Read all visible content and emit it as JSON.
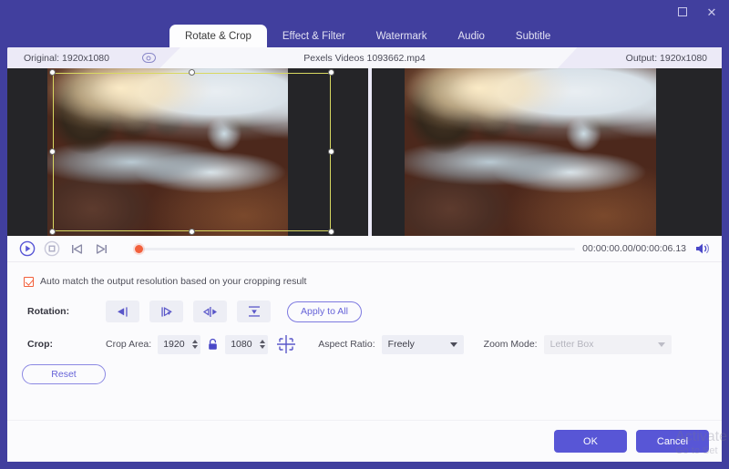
{
  "window": {
    "maximize_label": "maximize",
    "close_label": "close"
  },
  "tabs": [
    {
      "label": "Rotate & Crop",
      "active": true
    },
    {
      "label": "Effect & Filter",
      "active": false
    },
    {
      "label": "Watermark",
      "active": false
    },
    {
      "label": "Audio",
      "active": false
    },
    {
      "label": "Subtitle",
      "active": false
    }
  ],
  "info": {
    "original": "Original: 1920x1080",
    "filename": "Pexels Videos 1093662.mp4",
    "output": "Output: 1920x1080",
    "eye_icon": "eye-icon"
  },
  "player": {
    "play_icon": "play-circle-icon",
    "stop_icon": "stop-circle-icon",
    "prev_icon": "skip-previous-icon",
    "next_icon": "skip-next-icon",
    "timecode": "00:00:00.00/00:00:06.13",
    "volume_icon": "speaker-icon"
  },
  "settings": {
    "auto_match_label": "Auto match the output resolution based on your cropping result",
    "auto_match_checked": true,
    "rotation_label": "Rotation:",
    "rotation_buttons": [
      {
        "name": "rotate-left-icon"
      },
      {
        "name": "rotate-right-icon"
      },
      {
        "name": "flip-horizontal-icon"
      },
      {
        "name": "flip-vertical-icon"
      }
    ],
    "apply_to_all_label": "Apply to All",
    "crop_label": "Crop:",
    "crop_area_label": "Crop Area:",
    "crop_width": "1920",
    "crop_height": "1080",
    "lock_icon": "lock-icon",
    "crop_grid_icon": "crop-grid-icon",
    "aspect_ratio_label": "Aspect Ratio:",
    "aspect_ratio_value": "Freely",
    "zoom_mode_label": "Zoom Mode:",
    "zoom_mode_value": "Letter Box",
    "zoom_mode_disabled": true,
    "reset_label": "Reset"
  },
  "footer": {
    "ok_label": "OK",
    "cancel_label": "Cancel",
    "watermark_line1": "Activate",
    "watermark_line2": "Go to Set"
  },
  "colors": {
    "brand": "#413f9e",
    "accent": "#5856d6",
    "checkbox": "#f2603c",
    "crop_outline": "#d8d861",
    "playhead": "#f2603c"
  }
}
